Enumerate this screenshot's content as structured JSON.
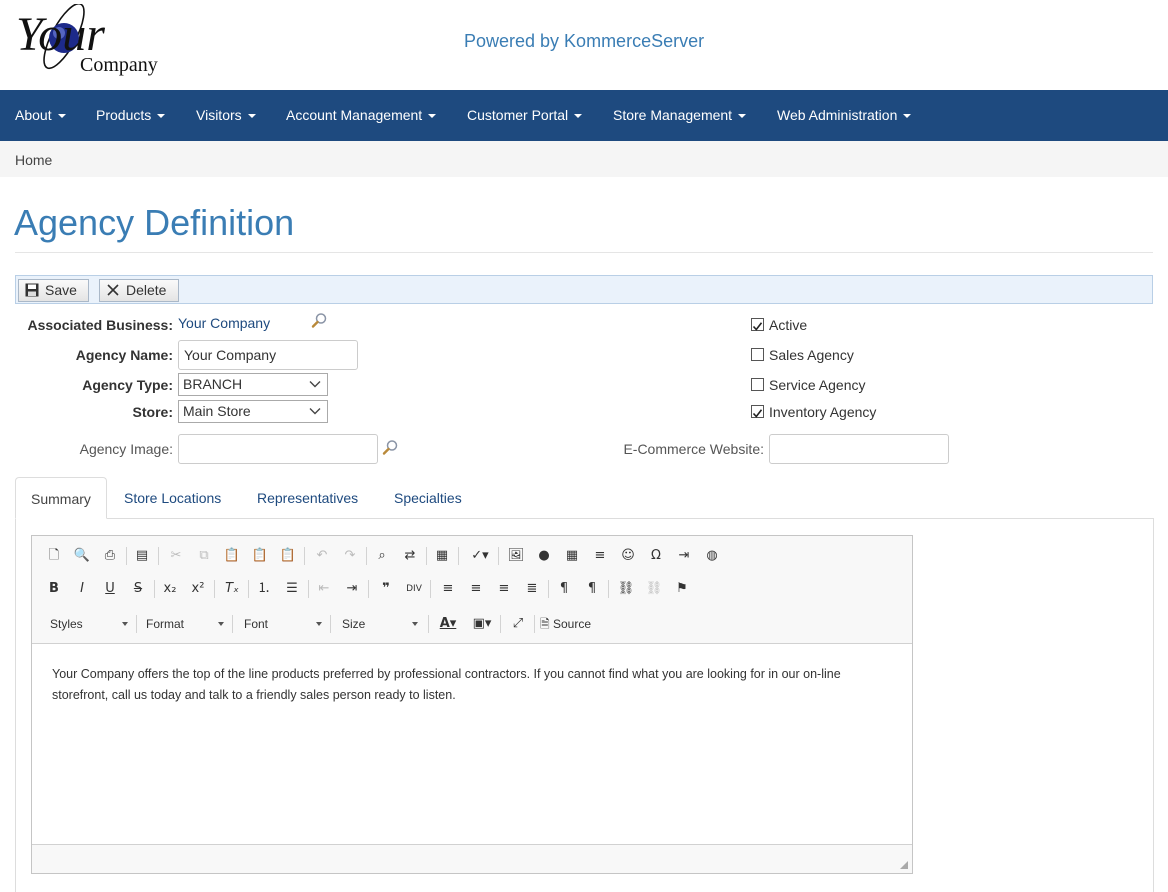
{
  "header": {
    "logo_main": "Your",
    "logo_sub": "Company",
    "powered_by": "Powered by KommerceServer"
  },
  "nav": {
    "items": [
      {
        "label": "About"
      },
      {
        "label": "Products"
      },
      {
        "label": "Visitors"
      },
      {
        "label": "Account Management"
      },
      {
        "label": "Customer Portal"
      },
      {
        "label": "Store Management"
      },
      {
        "label": "Web Administration"
      }
    ]
  },
  "breadcrumb": {
    "home": "Home"
  },
  "page": {
    "title": "Agency Definition"
  },
  "actions": {
    "save": "Save",
    "delete": "Delete"
  },
  "form": {
    "associated_business": {
      "label": "Associated Business:",
      "value": "Your Company"
    },
    "agency_name": {
      "label": "Agency Name:",
      "value": "Your Company"
    },
    "agency_type": {
      "label": "Agency Type:",
      "value": "BRANCH"
    },
    "store": {
      "label": "Store:",
      "value": "Main Store"
    },
    "agency_image": {
      "label": "Agency Image:",
      "value": ""
    },
    "ecommerce_website": {
      "label": "E-Commerce Website:",
      "value": ""
    },
    "checkboxes": [
      {
        "label": "Active",
        "checked": true
      },
      {
        "label": "Sales Agency",
        "checked": false
      },
      {
        "label": "Service Agency",
        "checked": false
      },
      {
        "label": "Inventory Agency",
        "checked": true
      }
    ]
  },
  "tabs": [
    {
      "label": "Summary",
      "active": true
    },
    {
      "label": "Store Locations",
      "active": false
    },
    {
      "label": "Representatives",
      "active": false
    },
    {
      "label": "Specialties",
      "active": false
    }
  ],
  "editor": {
    "combos": {
      "styles": "Styles",
      "format": "Format",
      "font": "Font",
      "size": "Size"
    },
    "source_label": "Source",
    "content": "Your Company offers the top of the line products preferred by professional contractors. If you cannot find what you are looking for in our on-line storefront, call us today and talk to a friendly sales person ready to listen."
  },
  "colors": {
    "nav_bg": "#1e4a7f",
    "accent": "#3a7db4",
    "link": "#1e4a7f"
  }
}
